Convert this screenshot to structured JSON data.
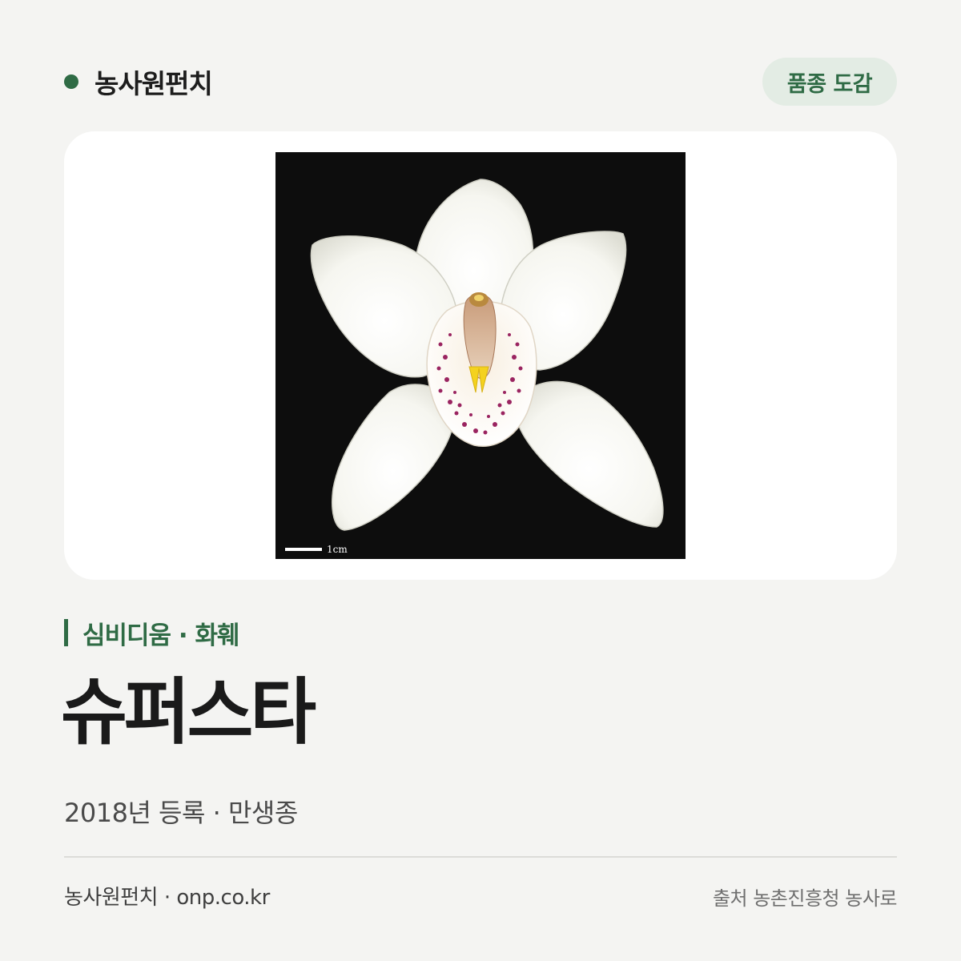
{
  "header": {
    "brand_name": "농사원펀치",
    "badge_label": "품종 도감"
  },
  "photo": {
    "subject": "white cymbidium orchid flower",
    "scale_label": "1cm"
  },
  "variety": {
    "category": "심비디움 · 화훼",
    "name": "슈퍼스타",
    "registration": "2018년 등록 · 만생종"
  },
  "footer": {
    "site": "농사원펀치 · onp.co.kr",
    "source": "출처 농촌진흥청 농사로"
  },
  "colors": {
    "background": "#f4f4f2",
    "accent": "#2f6b45",
    "badge_bg": "#e3ece4",
    "photo_bg": "#0d0d0d"
  }
}
